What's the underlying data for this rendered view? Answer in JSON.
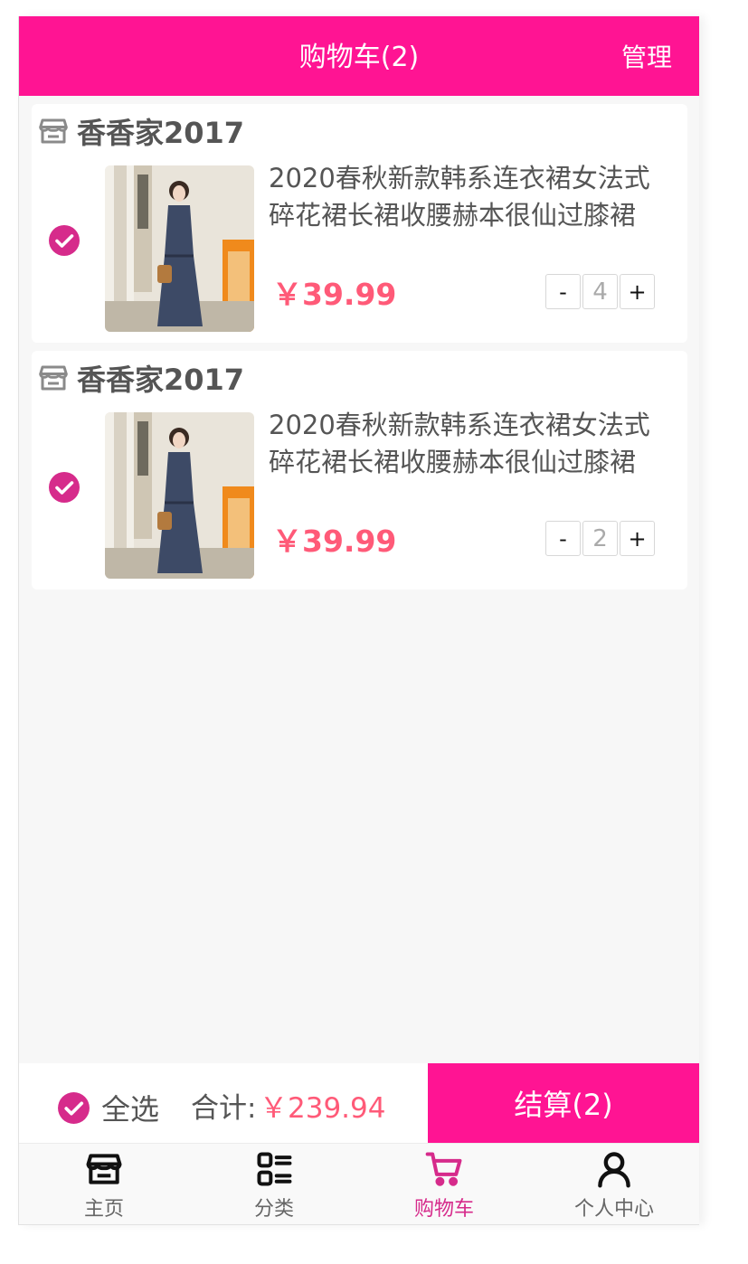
{
  "header": {
    "title": "购物车(2)",
    "manage_label": "管理"
  },
  "cart_items": [
    {
      "store_name": "香香家2017",
      "product_name": "2020春秋新款韩系连衣裙女法式碎花裙长裙收腰赫本很仙过膝裙",
      "price": "￥39.99",
      "quantity": "4",
      "minus_label": "-",
      "plus_label": "+",
      "selected": true
    },
    {
      "store_name": "香香家2017",
      "product_name": "2020春秋新款韩系连衣裙女法式碎花裙长裙收腰赫本很仙过膝裙",
      "price": "￥39.99",
      "quantity": "2",
      "minus_label": "-",
      "plus_label": "+",
      "selected": true
    }
  ],
  "checkout": {
    "select_all_label": "全选",
    "total_label": "合计:",
    "total_value": "￥239.94",
    "checkout_button": "结算(2)"
  },
  "tabbar": {
    "items": [
      {
        "label": "主页",
        "icon": "store-icon"
      },
      {
        "label": "分类",
        "icon": "category-icon"
      },
      {
        "label": "购物车",
        "icon": "cart-icon",
        "active": true
      },
      {
        "label": "个人中心",
        "icon": "user-icon"
      }
    ]
  },
  "colors": {
    "brand": "#ff1493",
    "price": "#ff5a78",
    "check": "#d62b8b",
    "background": "#f7f7f7"
  }
}
